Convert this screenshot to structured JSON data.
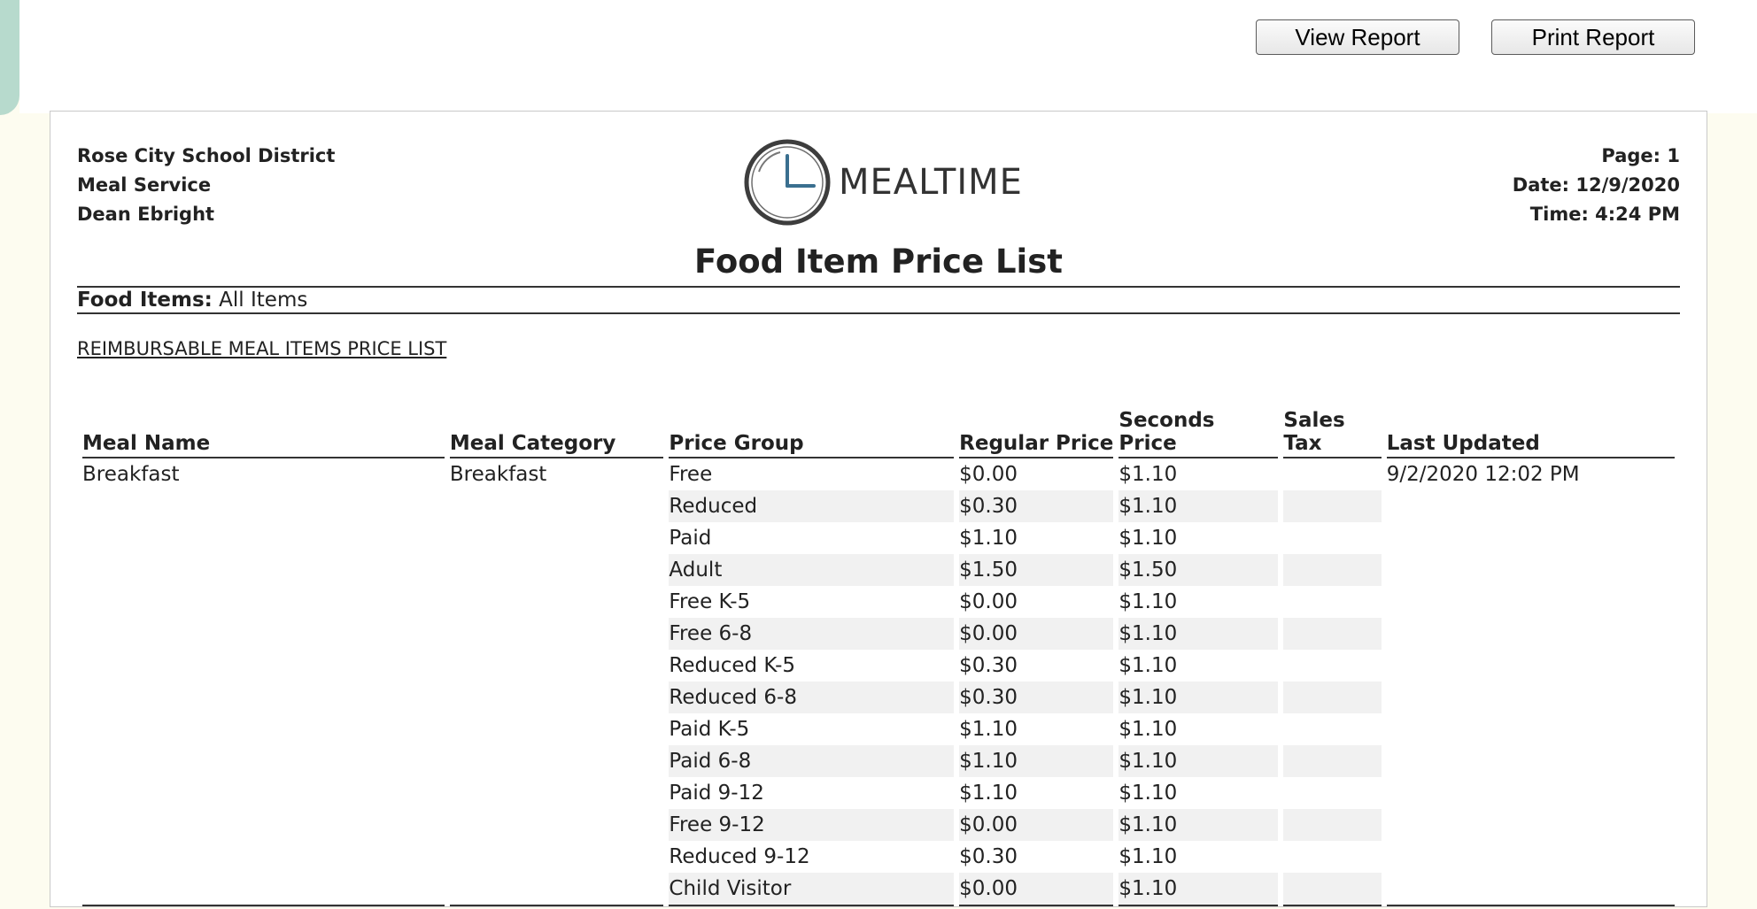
{
  "toolbar": {
    "view_label": "View Report",
    "print_label": "Print Report"
  },
  "header": {
    "left": [
      "Rose City School District",
      "Meal Service",
      "Dean Ebright"
    ],
    "right": [
      "Page: 1",
      "Date: 12/9/2020",
      "Time: 4:24 PM"
    ],
    "logo_text": "MEALTIME",
    "title": "Food Item Price List",
    "filter_label": "Food Items:",
    "filter_value": "All Items",
    "section_title": "REIMBURSABLE MEAL ITEMS PRICE LIST"
  },
  "table": {
    "columns": [
      "Meal Name",
      "Meal Category",
      "Price Group",
      "Regular Price",
      "Seconds Price",
      "Sales Tax",
      "Last Updated"
    ],
    "meal_name": "Breakfast",
    "meal_category": "Breakfast",
    "last_updated": "9/2/2020 12:02 PM",
    "rows": [
      {
        "group": "Free",
        "regular": "$0.00",
        "seconds": "$1.10",
        "tax": ""
      },
      {
        "group": "Reduced",
        "regular": "$0.30",
        "seconds": "$1.10",
        "tax": ""
      },
      {
        "group": "Paid",
        "regular": "$1.10",
        "seconds": "$1.10",
        "tax": ""
      },
      {
        "group": "Adult",
        "regular": "$1.50",
        "seconds": "$1.50",
        "tax": ""
      },
      {
        "group": "Free K-5",
        "regular": "$0.00",
        "seconds": "$1.10",
        "tax": ""
      },
      {
        "group": "Free 6-8",
        "regular": "$0.00",
        "seconds": "$1.10",
        "tax": ""
      },
      {
        "group": "Reduced K-5",
        "regular": "$0.30",
        "seconds": "$1.10",
        "tax": ""
      },
      {
        "group": "Reduced 6-8",
        "regular": "$0.30",
        "seconds": "$1.10",
        "tax": ""
      },
      {
        "group": "Paid K-5",
        "regular": "$1.10",
        "seconds": "$1.10",
        "tax": ""
      },
      {
        "group": "Paid 6-8",
        "regular": "$1.10",
        "seconds": "$1.10",
        "tax": ""
      },
      {
        "group": "Paid 9-12",
        "regular": "$1.10",
        "seconds": "$1.10",
        "tax": ""
      },
      {
        "group": "Free 9-12",
        "regular": "$0.00",
        "seconds": "$1.10",
        "tax": ""
      },
      {
        "group": "Reduced 9-12",
        "regular": "$0.30",
        "seconds": "$1.10",
        "tax": ""
      },
      {
        "group": "Child Visitor",
        "regular": "$0.00",
        "seconds": "$1.10",
        "tax": ""
      }
    ]
  },
  "colors": {
    "accent_tab": "#b7dacd",
    "page_bg": "#fdfcf0",
    "row_shade": "#f1f1f1"
  },
  "icons": {
    "logo": "clock-icon"
  }
}
